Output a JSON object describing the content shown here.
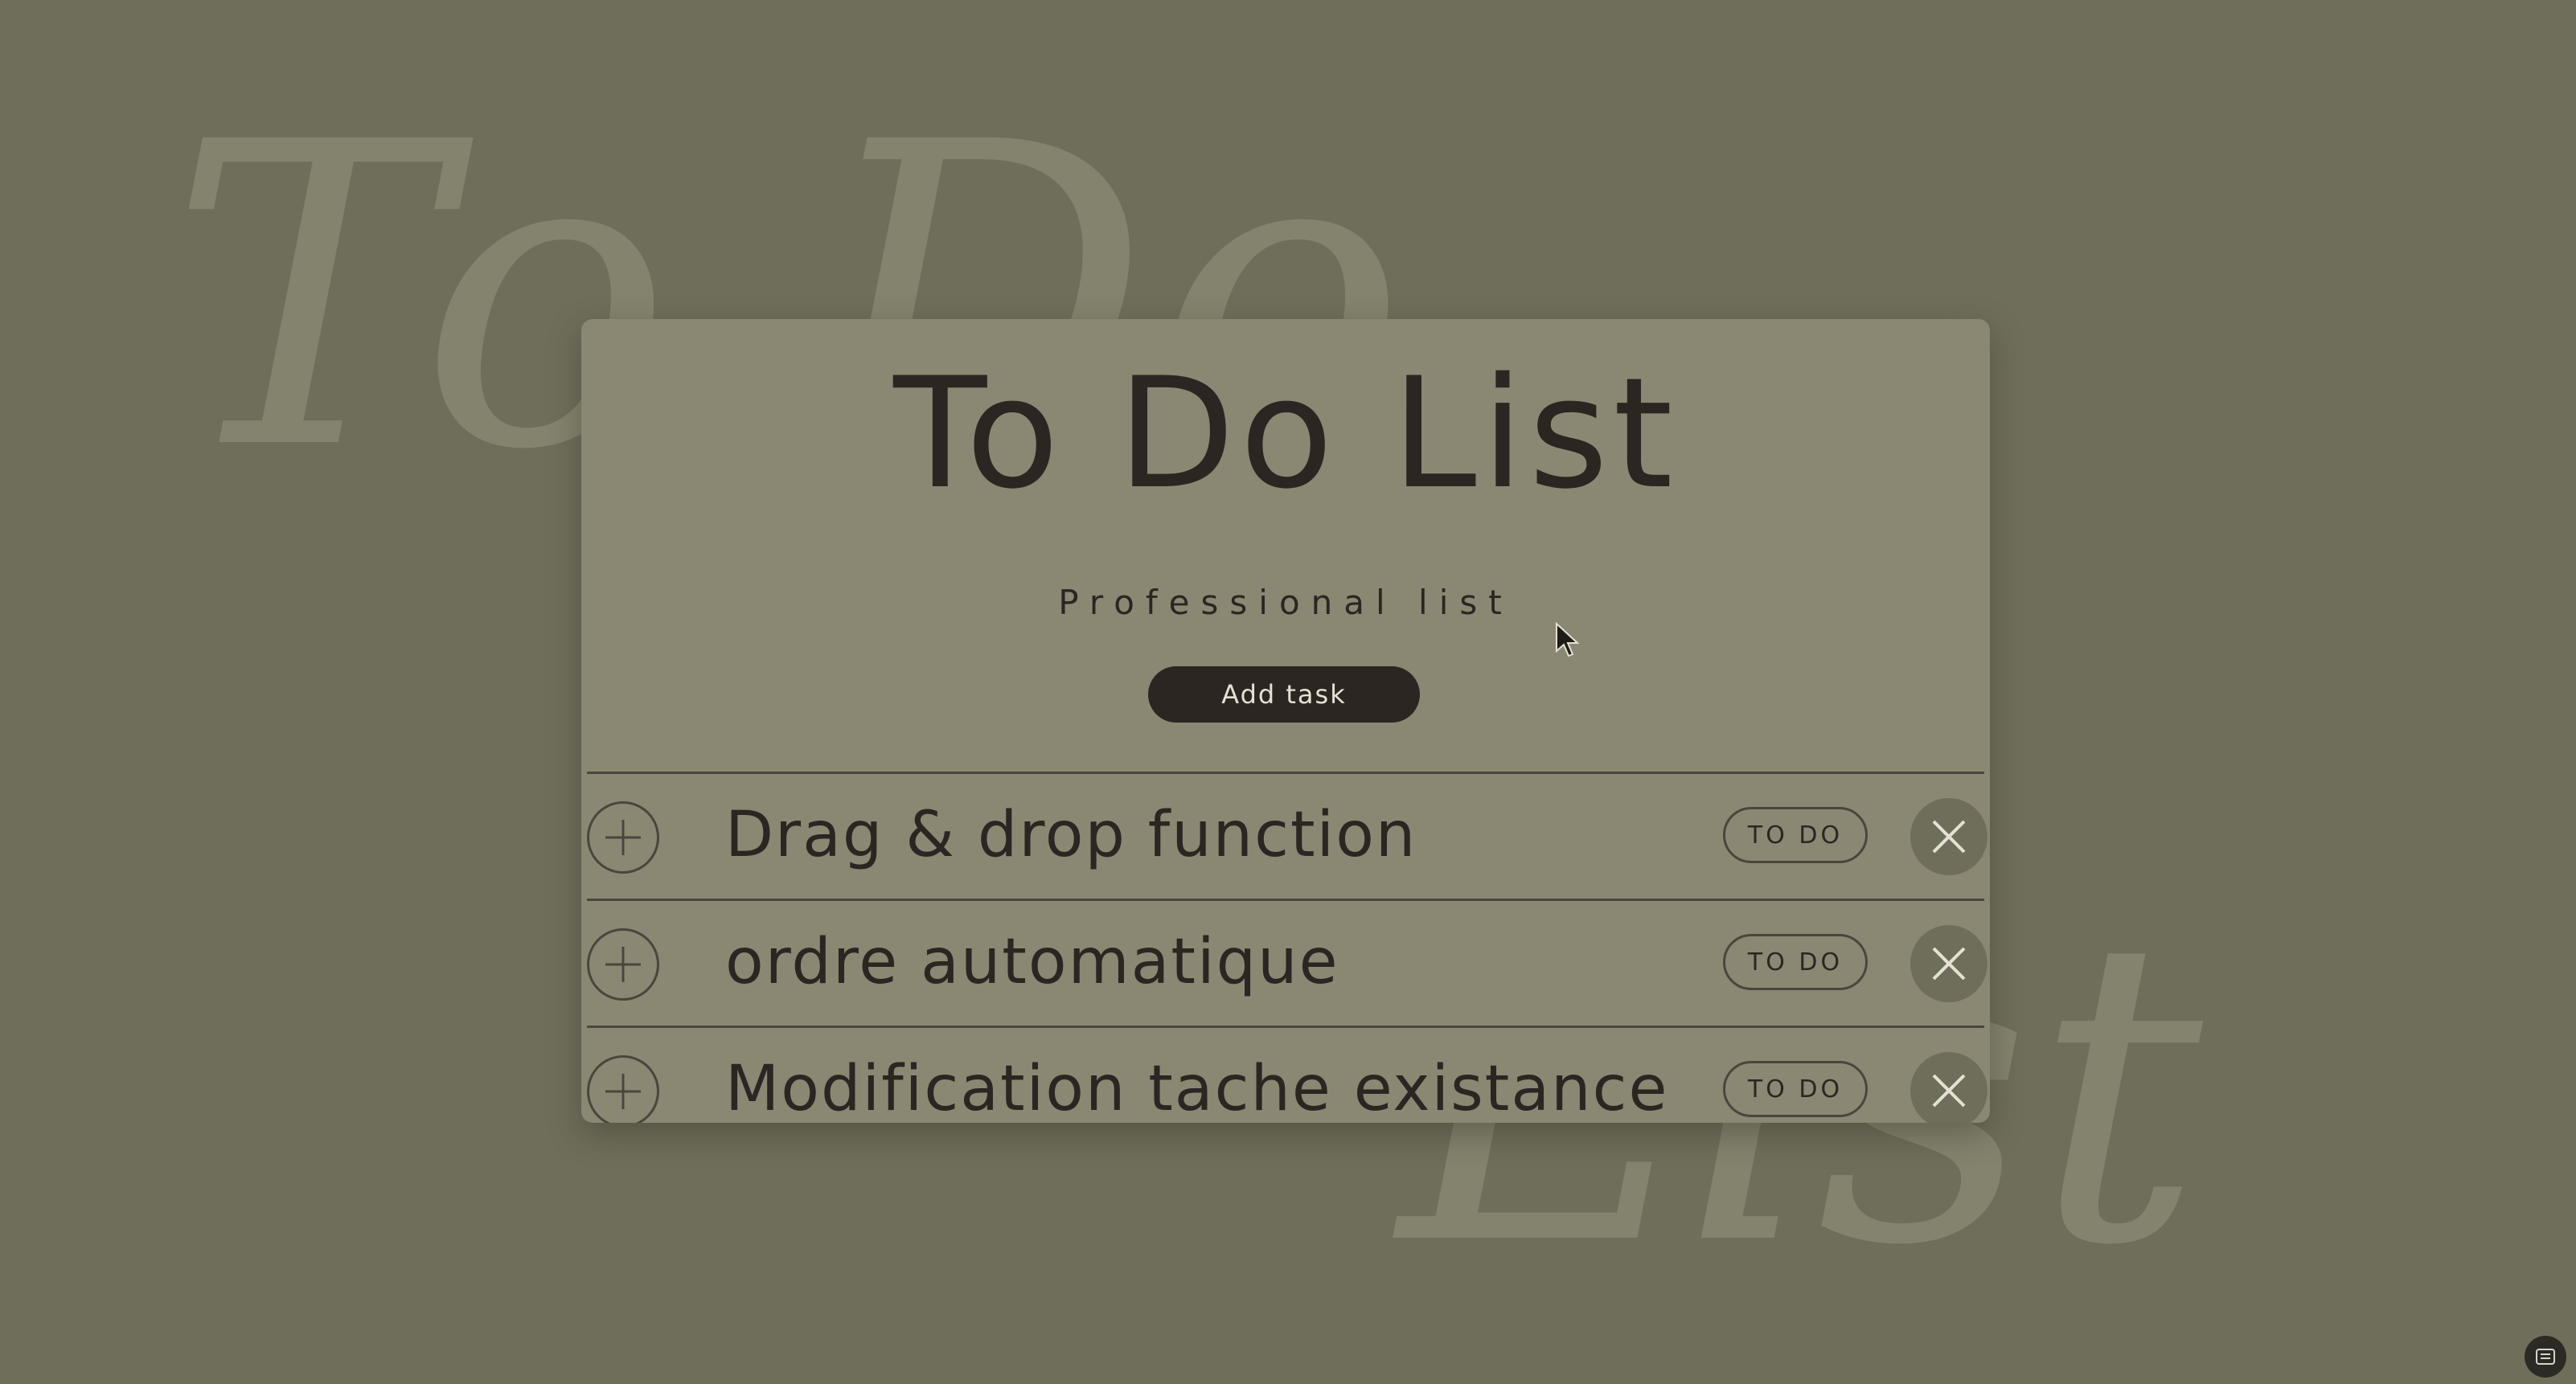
{
  "background": {
    "top_word": "To Do",
    "bottom_word": "List",
    "color": "#6f6e5a"
  },
  "card": {
    "title": "To Do List",
    "subtitle": "Professional list",
    "add_button_label": "Add task",
    "color": "#8a8873"
  },
  "tasks": [
    {
      "name": "Drag & drop function",
      "status": "TO DO"
    },
    {
      "name": "ordre automatique",
      "status": "TO DO"
    },
    {
      "name": "Modification tache existance",
      "status": "TO DO"
    }
  ],
  "icons": {
    "add": "plus-icon",
    "delete": "close-icon",
    "cursor": "mouse-cursor-icon",
    "corner": "screen-capture-icon"
  }
}
